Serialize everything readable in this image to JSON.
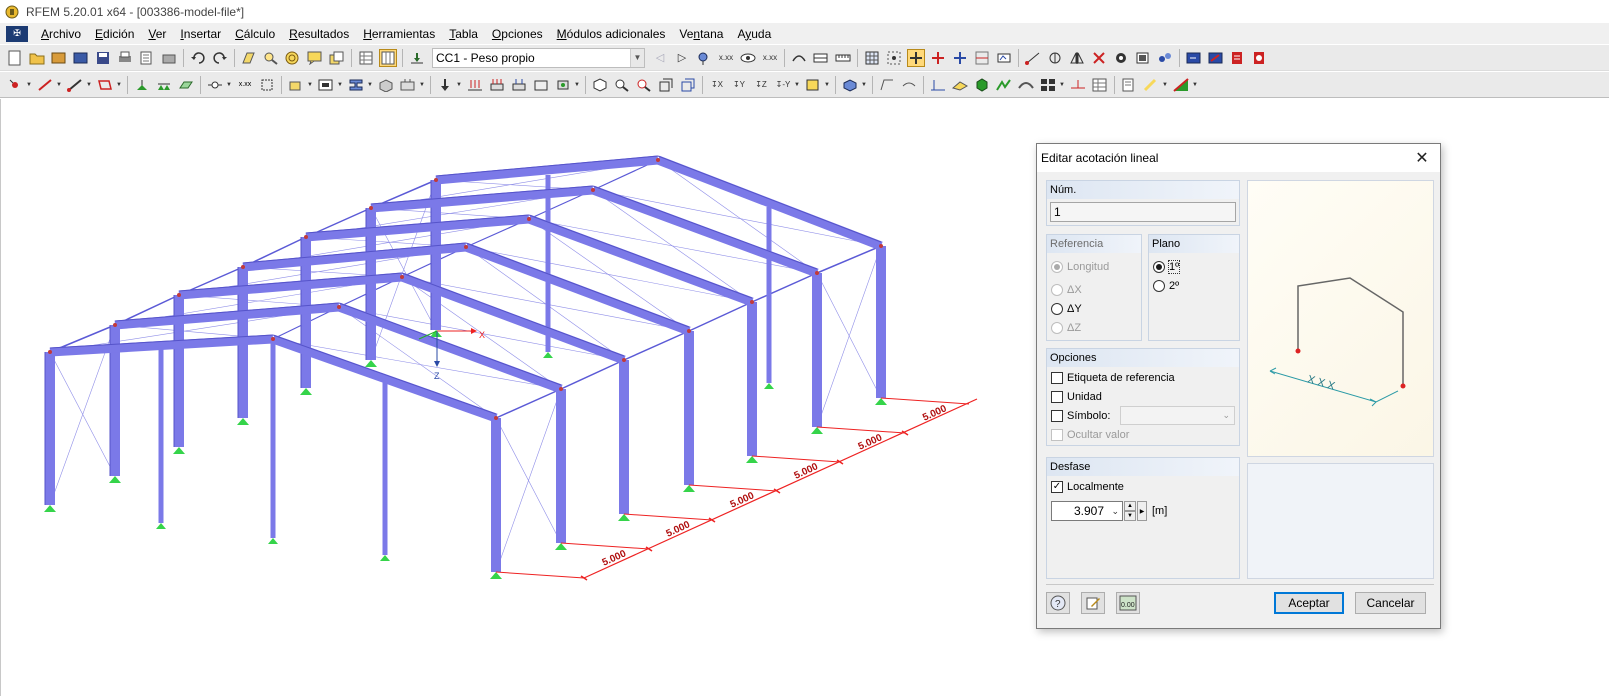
{
  "window": {
    "title": "RFEM 5.20.01 x64 - [003386-model-file*]"
  },
  "menu": {
    "items": [
      {
        "pre": "",
        "u": "A",
        "post": "rchivo"
      },
      {
        "pre": "",
        "u": "E",
        "post": "dición"
      },
      {
        "pre": "",
        "u": "V",
        "post": "er"
      },
      {
        "pre": "",
        "u": "I",
        "post": "nsertar"
      },
      {
        "pre": "",
        "u": "C",
        "post": "álculo"
      },
      {
        "pre": "",
        "u": "R",
        "post": "esultados"
      },
      {
        "pre": "",
        "u": "H",
        "post": "erramientas"
      },
      {
        "pre": "",
        "u": "T",
        "post": "abla"
      },
      {
        "pre": "",
        "u": "O",
        "post": "pciones"
      },
      {
        "pre": "",
        "u": "M",
        "post": "ódulos adicionales"
      },
      {
        "pre": "Ve",
        "u": "n",
        "post": "tana"
      },
      {
        "pre": "A",
        "u": "y",
        "post": "uda"
      }
    ]
  },
  "toolbar": {
    "load_case": "CC1 - Peso propio"
  },
  "model": {
    "axis_x": "X",
    "axis_z": "Z",
    "dimensions": [
      "5.000",
      "5.000",
      "5.000",
      "5.000",
      "5.000",
      "5.000"
    ]
  },
  "dialog": {
    "title": "Editar acotación lineal",
    "num_label": "Núm.",
    "num_value": "1",
    "referencia": {
      "label": "Referencia",
      "options": [
        "Longitud",
        "ΔX",
        "ΔY",
        "ΔZ"
      ]
    },
    "plano": {
      "label": "Plano",
      "options": [
        "1º",
        "2º"
      ]
    },
    "opciones": {
      "label": "Opciones",
      "etiqueta": "Etiqueta de referencia",
      "unidad": "Unidad",
      "simbolo": "Símbolo:",
      "ocultar": "Ocultar valor"
    },
    "desfase": {
      "label": "Desfase",
      "localmente": "Localmente",
      "value": "3.907",
      "unit": "[m]"
    },
    "preview_label": "X X X",
    "buttons": {
      "ok": "Aceptar",
      "cancel": "Cancelar"
    }
  }
}
